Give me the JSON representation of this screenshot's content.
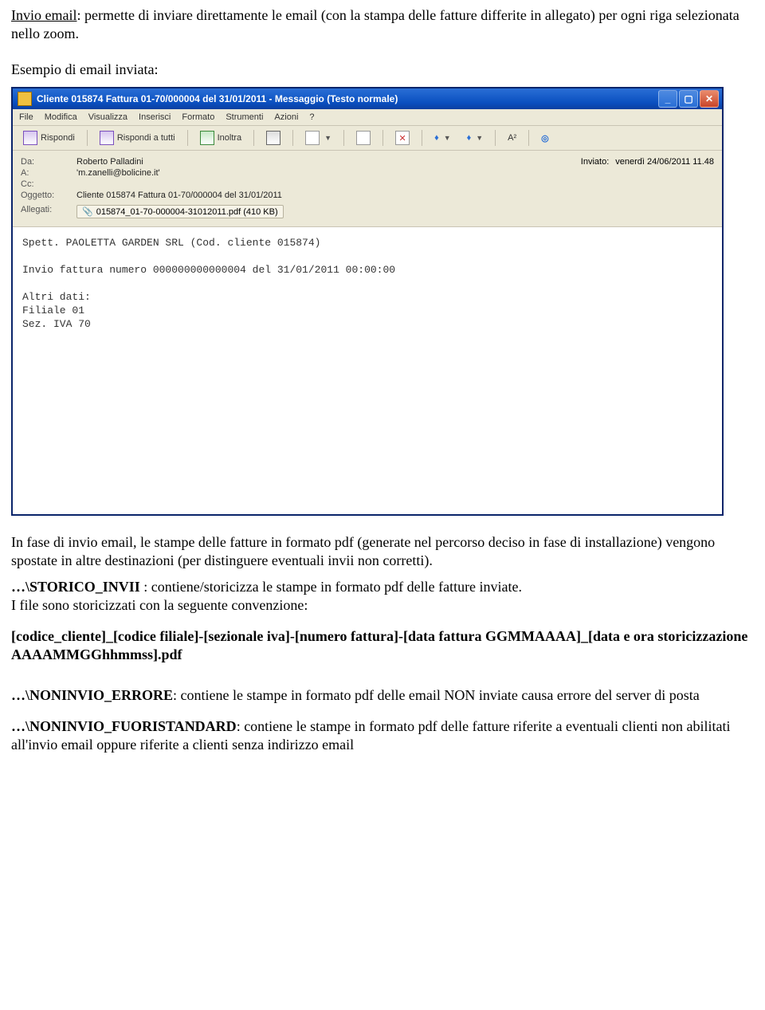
{
  "doc": {
    "intro_label": "Invio email",
    "intro_rest": ": permette di inviare direttamente le email (con la stampa delle fatture differite in allegato) per ogni riga selezionata nello zoom.",
    "example_label": "Esempio di email inviata:",
    "after_window": "In fase di invio email, le stampe delle fatture in formato pdf (generate nel percorso deciso in fase di installazione) vengono spostate in altre destinazioni (per distinguere eventuali invii non corretti).",
    "storico_bold": "…\\STORICO_INVII",
    "storico_rest": " : contiene/storicizza le stampe in formato pdf delle fatture inviate.",
    "storico_line2": "I file sono storicizzati con la seguente convenzione:",
    "pattern": "[codice_cliente]_[codice filiale]-[sezionale iva]-[numero fattura]-[data fattura GGMMAAAA]_[data e ora storicizzazione AAAAMMGGhhmmss].pdf",
    "noninvio_err_bold": "…\\NONINVIO_ERRORE",
    "noninvio_err_rest": ": contiene le stampe in formato pdf delle email NON inviate causa errore del server di posta",
    "noninvio_fs_bold": "…\\NONINVIO_FUORISTANDARD",
    "noninvio_fs_rest": ": contiene le stampe in formato pdf delle fatture riferite a eventuali clienti non abilitati all'invio email oppure riferite a clienti senza indirizzo email"
  },
  "outlook": {
    "title": "Cliente 015874 Fattura 01-70/000004 del 31/01/2011 - Messaggio (Testo normale)",
    "menu": {
      "file": "File",
      "modifica": "Modifica",
      "visualizza": "Visualizza",
      "inserisci": "Inserisci",
      "formato": "Formato",
      "strumenti": "Strumenti",
      "azioni": "Azioni",
      "help": "?"
    },
    "toolbar": {
      "rispondi": "Rispondi",
      "rispondi_tutti": "Rispondi a tutti",
      "inoltra": "Inoltra",
      "a2": "A²"
    },
    "hdr": {
      "da_label": "Da:",
      "da_value": "Roberto Palladini",
      "inviato_label": "Inviato:",
      "inviato_value": "venerdì 24/06/2011 11.48",
      "a_label": "A:",
      "a_value": "'m.zanelli@bolicine.it'",
      "cc_label": "Cc:",
      "cc_value": "",
      "ogg_label": "Oggetto:",
      "ogg_value": "Cliente 015874 Fattura 01-70/000004 del 31/01/2011",
      "allegati_label": "Allegati:",
      "allegato_name": "015874_01-70-000004-31012011.pdf (410 KB)"
    },
    "body": {
      "l1": "Spett. PAOLETTA GARDEN SRL (Cod. cliente 015874)",
      "l2": "Invio fattura numero 000000000000004 del 31/01/2011 00:00:00",
      "l3": "Altri dati:",
      "l4": "Filiale 01",
      "l5": "Sez. IVA 70"
    }
  }
}
